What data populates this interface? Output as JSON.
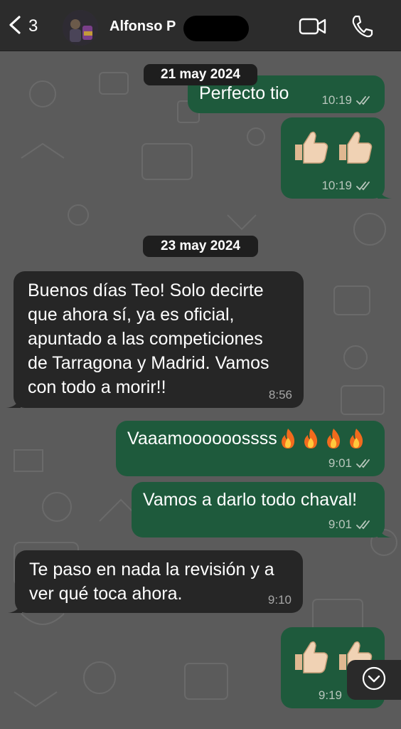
{
  "header": {
    "back_count": "3",
    "contact_name": "Alfonso P"
  },
  "dates": [
    "21 may 2024",
    "23 may 2024"
  ],
  "messages": [
    {
      "dir": "out",
      "text": "Perfecto tio",
      "time": "10:19"
    },
    {
      "dir": "out",
      "emoji": [
        "thumbs-up-icon",
        "thumbs-up-icon"
      ],
      "time": "10:19"
    },
    {
      "dir": "in",
      "text": "Buenos días Teo! Solo decirte\nque ahora sí, ya es oficial,\napuntado a las competiciones\nde Tarragona y Madrid. Vamos\ncon todo a morir!!",
      "time": "8:56"
    },
    {
      "dir": "out",
      "text": "Vaaamoooooossss",
      "emoji": [
        "fire-icon",
        "fire-icon",
        "fire-icon",
        "fire-icon"
      ],
      "time": "9:01"
    },
    {
      "dir": "out",
      "text": "Vamos a darlo todo chaval!",
      "time": "9:01"
    },
    {
      "dir": "in",
      "text": "Te paso en nada la revisión y a\nver qué toca ahora.",
      "time": "9:10"
    },
    {
      "dir": "out",
      "emoji": [
        "thumbs-up-icon",
        "thumbs-up-icon"
      ],
      "time": "9:19"
    }
  ],
  "colors": {
    "header_bg": "#2c2c2c",
    "wallpaper": "#5b5b5b",
    "outgoing_bubble": "#1e5a3c",
    "incoming_bubble": "#262626",
    "date_chip": "#1e1e1e"
  }
}
